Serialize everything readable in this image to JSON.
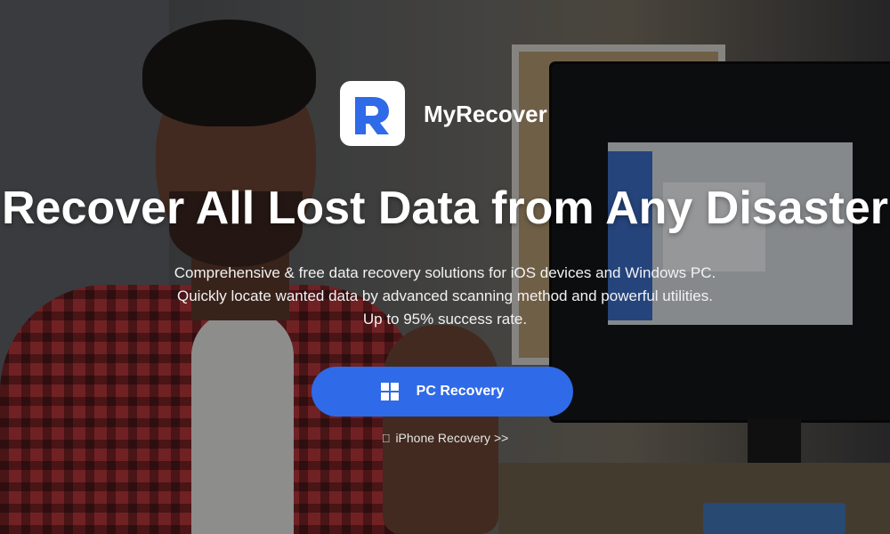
{
  "brand": {
    "name": "MyRecover",
    "logo_color": "#2f6ae8"
  },
  "hero": {
    "headline": "Recover All Lost Data from Any Disaster",
    "subtitle_lines": [
      "Comprehensive & free data recovery solutions for iOS devices and Windows PC.",
      "Quickly locate wanted data by advanced scanning method and powerful utilities.",
      "Up to 95% success rate."
    ]
  },
  "actions": {
    "primary": {
      "label": "PC Recovery",
      "icon": "windows-icon",
      "color": "#2f6ae8"
    },
    "secondary": {
      "label": "iPhone Recovery >>",
      "icon": "apple-icon"
    }
  }
}
